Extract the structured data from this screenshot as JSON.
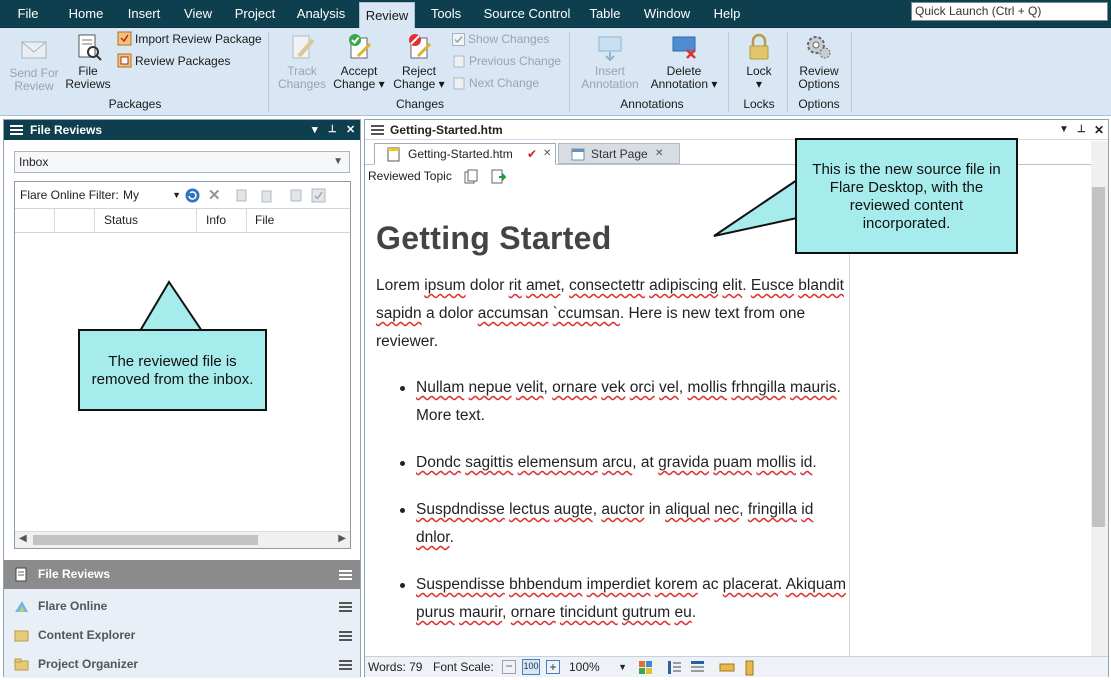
{
  "menubar": {
    "tabs": [
      "File",
      "Home",
      "Insert",
      "View",
      "Project",
      "Analysis",
      "Review",
      "Tools",
      "Source Control",
      "Table",
      "Window",
      "Help"
    ],
    "active_tab": "Review",
    "quick_launch_placeholder": "Quick Launch (Ctrl + Q)"
  },
  "ribbon": {
    "packages": {
      "send_for_review": "Send For\nReview",
      "file_reviews": "File\nReviews",
      "import_review_package": "Import Review Package",
      "review_packages": "Review Packages",
      "label": "Packages"
    },
    "changes": {
      "track_changes": "Track\nChanges",
      "accept_change": "Accept\nChange ▾",
      "reject_change": "Reject\nChange ▾",
      "show_changes": "Show Changes",
      "previous_change": "Previous Change",
      "next_change": "Next Change",
      "label": "Changes"
    },
    "annotations": {
      "insert_annotation": "Insert\nAnnotation",
      "delete_annotation": "Delete\nAnnotation ▾",
      "label": "Annotations"
    },
    "locks": {
      "lock": "Lock\n▾",
      "label": "Locks"
    },
    "options": {
      "review_options": "Review\nOptions",
      "label": "Options"
    }
  },
  "left_panel": {
    "title": "File Reviews",
    "controls": [
      "▾",
      "📌",
      "✕"
    ],
    "dropdown_value": "Inbox",
    "filter_label": "Flare Online Filter:",
    "filter_value": "My",
    "columns": [
      "",
      "",
      "Status",
      "Info",
      "File"
    ],
    "callout": "The reviewed file is removed from the inbox.",
    "nav": [
      {
        "label": "File Reviews",
        "icon": "file-reviews-icon"
      },
      {
        "label": "Flare Online",
        "icon": "flare-online-icon"
      },
      {
        "label": "Content Explorer",
        "icon": "content-explorer-icon"
      },
      {
        "label": "Project Organizer",
        "icon": "project-organizer-icon"
      }
    ]
  },
  "right_panel": {
    "title": "Getting-Started.htm",
    "tabs": [
      {
        "label": "Getting-Started.htm",
        "active": true
      },
      {
        "label": "Start Page",
        "active": false
      }
    ],
    "toolbar_label": "Reviewed Topic",
    "callout": "This is the new source file in Flare Desktop, with the reviewed content incorporated.",
    "document": {
      "heading": "Getting Started",
      "paragraph": [
        {
          "t": "Lorem ",
          "e": false
        },
        {
          "t": "ipsum",
          "e": true
        },
        {
          "t": " dolor ",
          "e": false
        },
        {
          "t": "rit",
          "e": true
        },
        {
          "t": " ",
          "e": false
        },
        {
          "t": "amet",
          "e": true
        },
        {
          "t": ", ",
          "e": false
        },
        {
          "t": "consectettr",
          "e": true
        },
        {
          "t": " ",
          "e": false
        },
        {
          "t": "adipiscing",
          "e": true
        },
        {
          "t": " ",
          "e": false
        },
        {
          "t": "elit",
          "e": true
        },
        {
          "t": ". ",
          "e": false
        },
        {
          "t": "Eusce",
          "e": true
        },
        {
          "t": " ",
          "e": false
        },
        {
          "t": "blandit",
          "e": true
        },
        {
          "t": " ",
          "e": false
        },
        {
          "t": "sapidn",
          "e": true
        },
        {
          "t": " a dolor ",
          "e": false
        },
        {
          "t": "accumsan",
          "e": true
        },
        {
          "t": " ",
          "e": false
        },
        {
          "t": "`ccumsan",
          "e": true
        },
        {
          "t": ". Here is new text from one reviewer.",
          "e": false
        }
      ],
      "bullets": [
        [
          {
            "t": "Nullam",
            "e": true
          },
          {
            "t": " ",
            "e": false
          },
          {
            "t": "nepue",
            "e": true
          },
          {
            "t": " ",
            "e": false
          },
          {
            "t": "velit",
            "e": true
          },
          {
            "t": ", ",
            "e": false
          },
          {
            "t": "ornare",
            "e": true
          },
          {
            "t": " ",
            "e": false
          },
          {
            "t": "vek",
            "e": true
          },
          {
            "t": " ",
            "e": false
          },
          {
            "t": "orci",
            "e": true
          },
          {
            "t": " ",
            "e": false
          },
          {
            "t": "vel",
            "e": true
          },
          {
            "t": ", ",
            "e": false
          },
          {
            "t": "mollis",
            "e": true
          },
          {
            "t": " ",
            "e": false
          },
          {
            "t": "frhngilla",
            "e": true
          },
          {
            "t": " ",
            "e": false
          },
          {
            "t": "mauris",
            "e": true
          },
          {
            "t": ". More text.",
            "e": false
          }
        ],
        [
          {
            "t": "Dondc",
            "e": true
          },
          {
            "t": " ",
            "e": false
          },
          {
            "t": "sagittis",
            "e": true
          },
          {
            "t": " ",
            "e": false
          },
          {
            "t": "elemensum",
            "e": true
          },
          {
            "t": " ",
            "e": false
          },
          {
            "t": "arcu",
            "e": true
          },
          {
            "t": ", at ",
            "e": false
          },
          {
            "t": "gravida",
            "e": true
          },
          {
            "t": " ",
            "e": false
          },
          {
            "t": "puam",
            "e": true
          },
          {
            "t": " ",
            "e": false
          },
          {
            "t": "mollis",
            "e": true
          },
          {
            "t": " ",
            "e": false
          },
          {
            "t": "id",
            "e": true
          },
          {
            "t": ".",
            "e": false
          }
        ],
        [
          {
            "t": "Suspdndisse",
            "e": true
          },
          {
            "t": " ",
            "e": false
          },
          {
            "t": "lectus",
            "e": true
          },
          {
            "t": " ",
            "e": false
          },
          {
            "t": "augte",
            "e": true
          },
          {
            "t": ", ",
            "e": false
          },
          {
            "t": "auctor",
            "e": true
          },
          {
            "t": " in ",
            "e": false
          },
          {
            "t": "aliqual",
            "e": true
          },
          {
            "t": " ",
            "e": false
          },
          {
            "t": "nec",
            "e": true
          },
          {
            "t": ", ",
            "e": false
          },
          {
            "t": "fringilla",
            "e": true
          },
          {
            "t": " ",
            "e": false
          },
          {
            "t": "id",
            "e": true
          },
          {
            "t": " ",
            "e": false
          },
          {
            "t": "dnlor",
            "e": true
          },
          {
            "t": ".",
            "e": false
          }
        ],
        [
          {
            "t": "Suspendisse",
            "e": true
          },
          {
            "t": " ",
            "e": false
          },
          {
            "t": "bhbendum",
            "e": true
          },
          {
            "t": " ",
            "e": false
          },
          {
            "t": "imperdiet",
            "e": true
          },
          {
            "t": " ",
            "e": false
          },
          {
            "t": "korem",
            "e": true
          },
          {
            "t": " ac ",
            "e": false
          },
          {
            "t": "placerat",
            "e": true
          },
          {
            "t": ". ",
            "e": false
          },
          {
            "t": "Akiquam",
            "e": true
          },
          {
            "t": " ",
            "e": false
          },
          {
            "t": "purus",
            "e": true
          },
          {
            "t": " ",
            "e": false
          },
          {
            "t": "maurir",
            "e": true
          },
          {
            "t": ", ",
            "e": false
          },
          {
            "t": "ornare",
            "e": true
          },
          {
            "t": " ",
            "e": false
          },
          {
            "t": "tincidunt",
            "e": true
          },
          {
            "t": " ",
            "e": false
          },
          {
            "t": "gutrum",
            "e": true
          },
          {
            "t": " ",
            "e": false
          },
          {
            "t": "eu",
            "e": true
          },
          {
            "t": ".",
            "e": false
          }
        ]
      ]
    },
    "statusbar": {
      "words_label": "Words: 79",
      "font_scale_label": "Font Scale:",
      "zoom": "100%"
    }
  },
  "colors": {
    "title_bar": "#0e3f4e",
    "ribbon": "#d9e7f4",
    "callout": "#a6ecec",
    "spell_error": "#dd3333"
  }
}
